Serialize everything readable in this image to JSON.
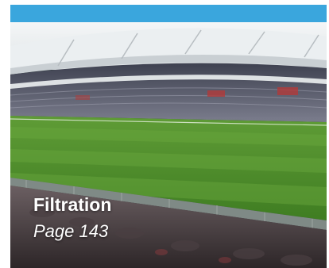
{
  "card": {
    "title": "Filtration",
    "page_ref": "Page 143",
    "image_subject": "stadium-pitch-photo"
  },
  "colors": {
    "accent": "#3aa6dd",
    "grass": "#4f8f2c",
    "roof": "#e7ecef",
    "seats": "#6d6f7e",
    "caption_text": "#ffffff"
  }
}
